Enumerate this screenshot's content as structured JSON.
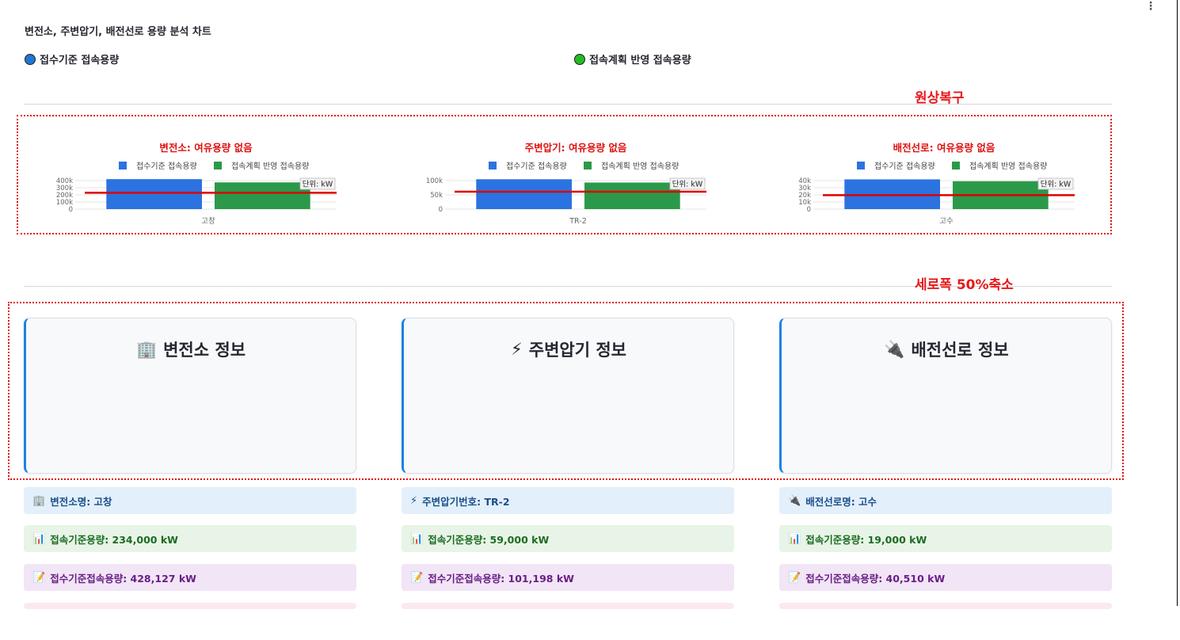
{
  "page": {
    "title": "변전소, 주변압기, 배전선로 용량 분석 차트",
    "legend": [
      {
        "label": "접수기준 접속용량",
        "color": "#1f77d4"
      },
      {
        "label": "접속계획 반영 접속용량",
        "color": "#22bb22"
      }
    ],
    "annotation_restore": "원상복구",
    "annotation_shrink": "세로폭 50%축소",
    "menu_icon": "⋮"
  },
  "colors": {
    "bar_blue": "#2b73e0",
    "bar_green": "#2a9a4a",
    "limit_line": "#dd0000"
  },
  "chart_data": [
    {
      "type": "bar",
      "title": "변전소: 여유용량 없음",
      "legend": [
        "접수기준 접속용량",
        "접속계획 반영 접속용량"
      ],
      "categories": [
        "고창"
      ],
      "series": [
        {
          "name": "접수기준 접속용량",
          "values": [
            428127
          ]
        },
        {
          "name": "접속계획 반영 접속용량",
          "values": [
            382000
          ]
        }
      ],
      "limit": 234000,
      "yticks": [
        "400k",
        "300k",
        "200k",
        "100k",
        "0"
      ],
      "ylim": [
        0,
        430000
      ],
      "unit_label": "단위: kW"
    },
    {
      "type": "bar",
      "title": "주변압기: 여유용량 없음",
      "legend": [
        "접수기준 접속용량",
        "접속계획 반영 접속용량"
      ],
      "categories": [
        "TR-2"
      ],
      "series": [
        {
          "name": "접수기준 접속용량",
          "values": [
            101198
          ]
        },
        {
          "name": "접속계획 반영 접속용량",
          "values": [
            90000
          ]
        }
      ],
      "limit": 59000,
      "yticks": [
        "100k",
        "50k",
        "0"
      ],
      "ylim": [
        0,
        102000
      ],
      "unit_label": "단위: kW"
    },
    {
      "type": "bar",
      "title": "배전선로: 여유용량 없음",
      "legend": [
        "접수기준 접속용량",
        "접속계획 반영 접속용량"
      ],
      "categories": [
        "고수"
      ],
      "series": [
        {
          "name": "접수기준 접속용량",
          "values": [
            40510
          ]
        },
        {
          "name": "접속계획 반영 접속용량",
          "values": [
            38000
          ]
        }
      ],
      "limit": 19000,
      "yticks": [
        "40k",
        "30k",
        "20k",
        "10k",
        "0"
      ],
      "ylim": [
        0,
        41000
      ],
      "unit_label": "단위: kW"
    }
  ],
  "cards": [
    {
      "title": "변전소 정보",
      "icon": "🏢",
      "rows": [
        "변전소명: 고창",
        "접속기준용량: 234,000 kW",
        "접수기준접속용량: 428,127 kW"
      ]
    },
    {
      "title": "주변압기 정보",
      "icon": "⚡",
      "rows": [
        "주변압기번호: TR-2",
        "접속기준용량: 59,000 kW",
        "접수기준접속용량: 101,198 kW"
      ]
    },
    {
      "title": "배전선로 정보",
      "icon": "🔌",
      "rows": [
        "배전선로명: 고수",
        "접속기준용량: 19,000 kW",
        "접수기준접속용량: 40,510 kW"
      ]
    }
  ],
  "row_icons": [
    "🏢",
    "📊",
    "📝"
  ]
}
